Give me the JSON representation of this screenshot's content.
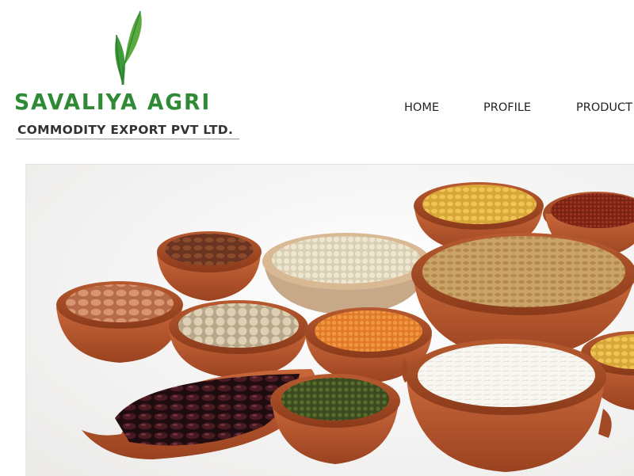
{
  "logo": {
    "brand_name": "SAVALIYA AGRI",
    "subtitle": "COMMODITY EXPORT PVT LTD.",
    "icon": "leaf-sprout-icon",
    "colors": {
      "brand_green": "#2f8a35",
      "subtitle_gray": "#333333"
    }
  },
  "nav": {
    "items": [
      {
        "label": "HOME"
      },
      {
        "label": "PROFILE"
      },
      {
        "label": "PRODUCT"
      }
    ]
  },
  "hero": {
    "image": "clay-bowls-of-grains-and-pulses",
    "colors": {
      "clay": "#b5562c",
      "background": "#f3f3f2"
    }
  }
}
